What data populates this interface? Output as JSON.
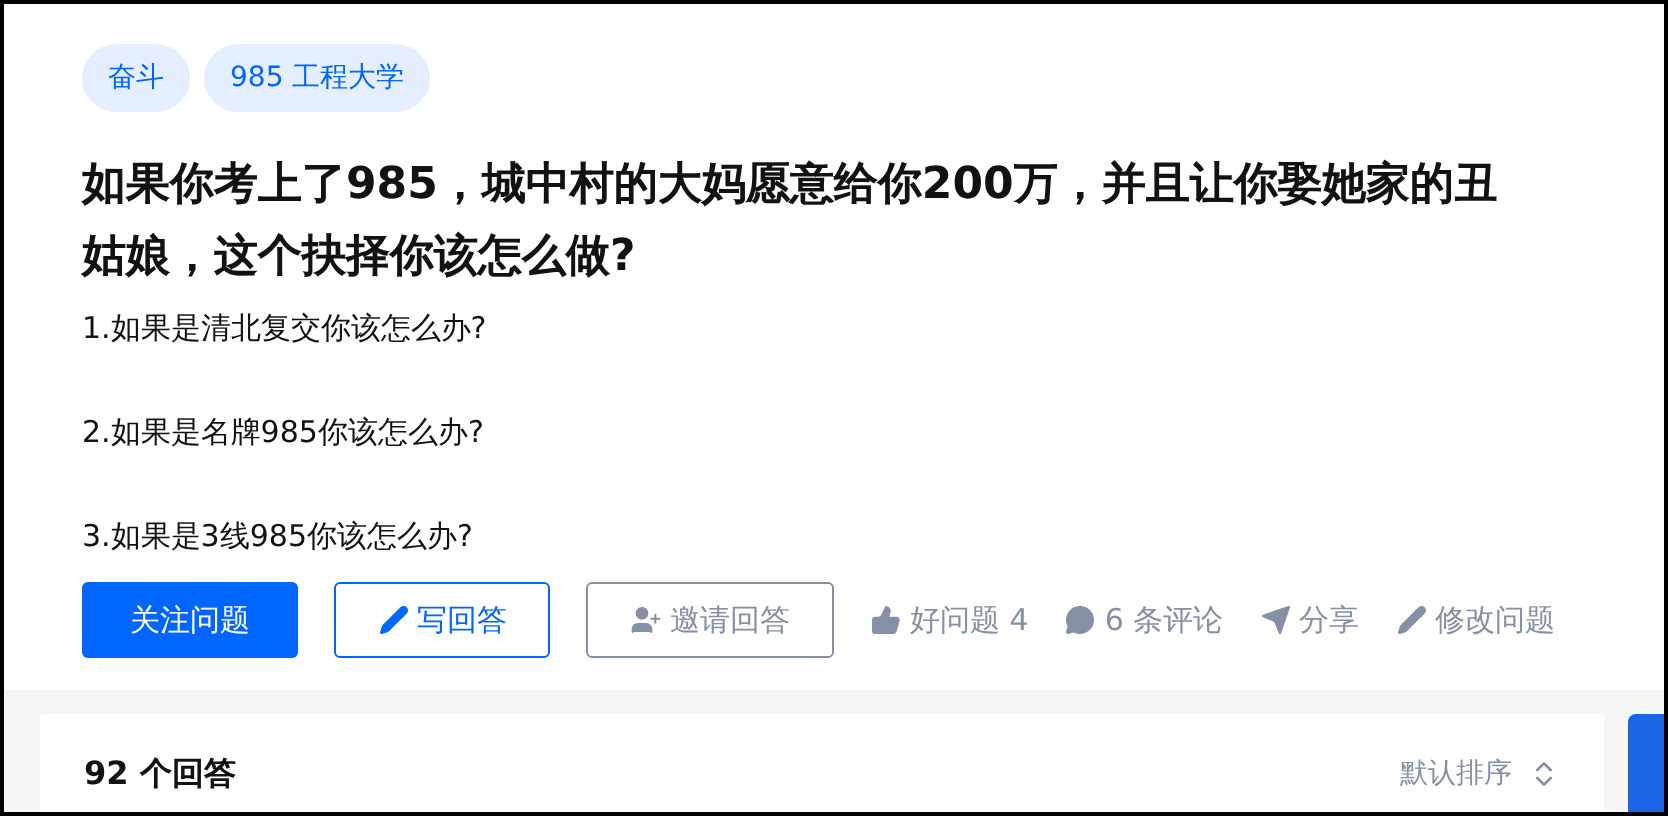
{
  "tags": [
    {
      "label": "奋斗"
    },
    {
      "label": "985 工程大学"
    }
  ],
  "question": {
    "title": "如果你考上了985，城中村的大妈愿意给你200万，并且让你娶她家的丑姑娘，这个抉择你该怎么做?",
    "body": [
      "1.如果是清北复交你该怎么办?",
      "2.如果是名牌985你该怎么办?",
      "3.如果是3线985你该怎么办?"
    ]
  },
  "actions": [
    {
      "kind": "primary",
      "label": "关注问题"
    },
    {
      "kind": "write",
      "label": "写回答"
    },
    {
      "kind": "invite",
      "label": "邀请回答"
    },
    {
      "kind": "like",
      "label": "好问题 4"
    },
    {
      "kind": "comment",
      "label": "6 条评论"
    },
    {
      "kind": "share",
      "label": "分享"
    },
    {
      "kind": "edit",
      "label": "修改问题"
    }
  ],
  "answers": {
    "count": "92 个回答",
    "sort": "默认排序"
  }
}
